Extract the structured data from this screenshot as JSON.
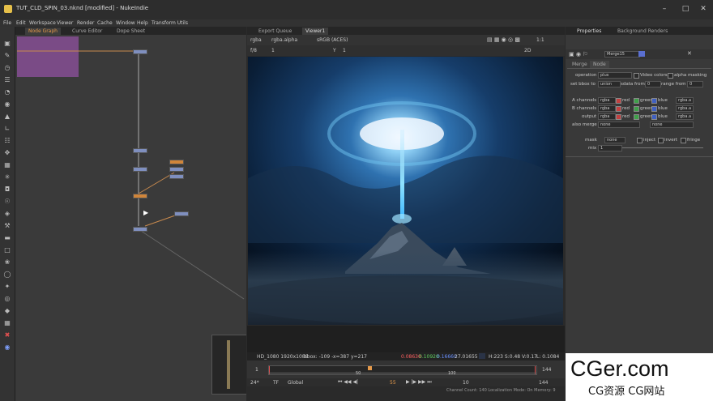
{
  "window": {
    "title": "TUT_CLD_SPIN_03.nknd [modified] - NukeIndie"
  },
  "menu": [
    "File",
    "Edit",
    "Workspace",
    "Viewer",
    "Render",
    "Cache",
    "Window",
    "Help",
    "Transform Utils"
  ],
  "node_graph": {
    "tabs": [
      "Node Graph",
      "Curve Editor",
      "Dope Sheet"
    ]
  },
  "viewer": {
    "tabs": [
      "Export Queue",
      "Viewer1"
    ],
    "channel": "rgba",
    "alpha": "rgba.alpha",
    "colorspace": "sRGB (ACES)",
    "ratio": "1:1",
    "mode": "2D",
    "fstop": "f/8",
    "frame_one": "1",
    "y_label": "Y",
    "y_value": "1",
    "status": {
      "format": "HD_1080 1920x1080",
      "bbox": "bbox: -109 -",
      "coords": "x=387 y=217",
      "r": "0.08630",
      "g": "0.10920",
      "b": "0.16660",
      "a": "27.01655",
      "hsv": "H:223 S:0.48 V:0.17",
      "l": "L: 0.1084"
    },
    "timeline": {
      "start": "1",
      "end": "144",
      "ticks": [
        "50",
        "100"
      ],
      "marker": "55",
      "end_marker": "144",
      "left_marker": "1"
    },
    "playback": {
      "fps": "24*",
      "tf": "TF",
      "global": "Global",
      "frame": "55",
      "step": "10",
      "end": "144"
    },
    "footer": "Channel Count: 140  Localization Mode: On  Memory: 9"
  },
  "properties": {
    "tabs": [
      "Properties",
      "Background Renders"
    ],
    "node_name": "Merge15",
    "subtabs": [
      "Merge",
      "Node"
    ],
    "operation_label": "operation",
    "operation": "plus",
    "video_colors": "Video colors",
    "alpha_masking": "alpha masking",
    "set_bbox_label": "set bbox to",
    "set_bbox": "union",
    "sdata_from": "sdata from",
    "range_from": "range from",
    "a_channels_label": "A channels",
    "b_channels_label": "B channels",
    "output_label": "output",
    "also_merge_label": "also merge",
    "rgba": "rgba",
    "red": "red",
    "green": "green",
    "blue": "blue",
    "alpha": "rgba.a",
    "none": "none",
    "mask_label": "mask",
    "inject": "inject",
    "invert": "invert",
    "fringe": "fringe",
    "mix_label": "mix",
    "mix_value": "1"
  },
  "watermark": {
    "line1": "CGer.com",
    "line2": "CG资源 CG网站"
  },
  "colors": {
    "accent": "#e69a4a",
    "node_blue": "#7f8fbf",
    "node_orange": "#d0853a",
    "backdrop": "#7a4b86"
  }
}
